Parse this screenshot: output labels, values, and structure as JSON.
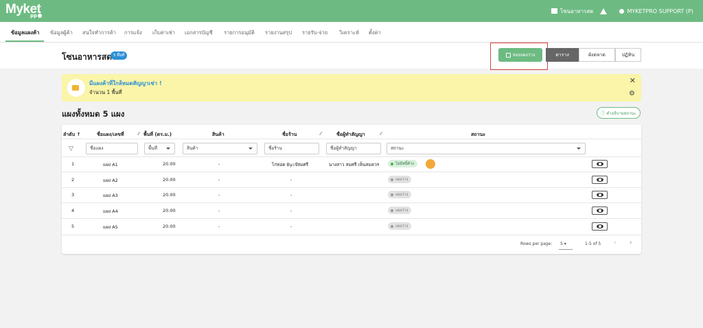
{
  "header": {
    "logo_main": "Myket",
    "logo_sub": "pp",
    "zone_name": "โซนอาหารสด",
    "user_name": "MYKETPRO SUPPORT (P)"
  },
  "nav": {
    "items": [
      "ข้อมูลแผงค้า",
      "ข้อมูลผู้ค้า",
      "สนใจทำการค้า",
      "การแจ้ง",
      "เก็บค่าเช่า",
      "เอกสารบัญชี",
      "รายการอนุมัติ",
      "รายงานสรุป",
      "รายรับ-จ่าย",
      "วิเคราะห์",
      "ตั้งค่า"
    ]
  },
  "title": {
    "page": "โซนอาหารสด",
    "badge": "5 พื้นที่",
    "book_button": "จองแผงว่าง",
    "views": [
      "ตาราง",
      "ผังตลาด",
      "ปฏิทิน"
    ]
  },
  "alert": {
    "title": "มีแผงค้าที่ใกล้หมดสัญญาเช่า !",
    "subtitle": "จำนวน 1 พื้นที่"
  },
  "section": {
    "title": "แผงทั้งหมด 5 แผง",
    "status_desc": "คำอธิบายสถานะ"
  },
  "table": {
    "headers": [
      "ลำดับ",
      "ชื่อแผง/เลขที่",
      "พื้นที่ (ตร.ม.)",
      "สินค้า",
      "ชื่อร้าน",
      "ชื่อผู้ทำสัญญา",
      "สถานะ"
    ],
    "sort_arrow": "↑",
    "filters": {
      "name": "ชื่อแผง",
      "area": "พื้นที่",
      "product": "สินค้า",
      "shop": "ชื่อร้าน",
      "contract": "ชื่อผู้ทำสัญญา",
      "status": "สถานะ"
    },
    "rows": [
      {
        "no": "1",
        "name": "แผง A1",
        "area": "20.00",
        "product": "-",
        "shop": "ไก่ทอด By.เจ๊สมศรี",
        "contract": "นางสาว สมศรี เห็นสมควร",
        "status": "ไม่มีหนี้ค้าง"
      },
      {
        "no": "2",
        "name": "แผง A2",
        "area": "20.00",
        "product": "-",
        "shop": "-",
        "contract": "",
        "status": "แผงว่าง"
      },
      {
        "no": "3",
        "name": "แผง A3",
        "area": "20.00",
        "product": "-",
        "shop": "-",
        "contract": "",
        "status": "แผงว่าง"
      },
      {
        "no": "4",
        "name": "แผง A4",
        "area": "20.00",
        "product": "-",
        "shop": "-",
        "contract": "",
        "status": "แผงว่าง"
      },
      {
        "no": "5",
        "name": "แผง A5",
        "area": "20.00",
        "product": "-",
        "shop": "-",
        "contract": "",
        "status": "แผงว่าง"
      }
    ]
  },
  "pagination": {
    "rows_label": "Rows per page:",
    "rows_value": "5",
    "range": "1-5 of 5"
  },
  "colors": {
    "brand": "#6dbb82",
    "highlight": "#d9413b",
    "alert_bg": "#faf5a8",
    "info_blue": "#2c8fd6"
  },
  "icons": [
    "store-icon",
    "home-icon",
    "user-icon",
    "calendar-icon",
    "megaphone-icon",
    "close-icon",
    "gear-icon",
    "help-circle-icon",
    "filter-icon",
    "eye-icon",
    "coin-icon",
    "chevron-left-icon",
    "chevron-right-icon"
  ]
}
